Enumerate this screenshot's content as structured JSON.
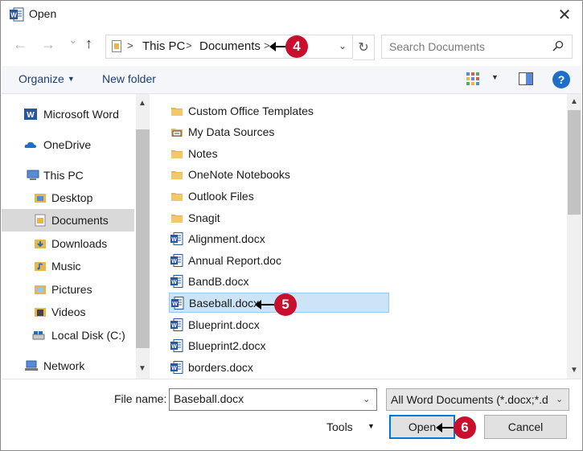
{
  "window": {
    "title": "Open",
    "app_icon": "word-app-icon",
    "close_glyph": "✕"
  },
  "address": {
    "back_glyph": "←",
    "forward_glyph": "→",
    "recent_glyph": "⌄",
    "up_glyph": "↑",
    "crumbs": [
      "This PC",
      "Documents"
    ],
    "sep_glyph": ">",
    "drop_glyph": "⌄",
    "refresh_glyph": "↻",
    "search_placeholder": "Search Documents"
  },
  "callouts": {
    "c4": "4",
    "c5": "5",
    "c6": "6",
    "color": "#c8102e"
  },
  "toolbar": {
    "organize": "Organize",
    "new_folder": "New folder",
    "caret": "▼",
    "help": "?"
  },
  "sidebar": {
    "items": [
      {
        "label": "Microsoft Word",
        "icon": "word-icon"
      },
      {
        "label": "OneDrive",
        "icon": "cloud-icon"
      },
      {
        "label": "This PC",
        "icon": "computer-icon"
      },
      {
        "label": "Desktop",
        "icon": "desktop-folder-icon"
      },
      {
        "label": "Documents",
        "icon": "documents-folder-icon"
      },
      {
        "label": "Downloads",
        "icon": "downloads-folder-icon"
      },
      {
        "label": "Music",
        "icon": "music-folder-icon"
      },
      {
        "label": "Pictures",
        "icon": "pictures-folder-icon"
      },
      {
        "label": "Videos",
        "icon": "videos-folder-icon"
      },
      {
        "label": "Local Disk (C:)",
        "icon": "disk-icon"
      },
      {
        "label": "Network",
        "icon": "network-icon"
      }
    ],
    "selected": "Documents"
  },
  "files": [
    {
      "name": "Custom Office Templates",
      "icon": "folder-icon"
    },
    {
      "name": "My Data Sources",
      "icon": "data-sources-folder-icon"
    },
    {
      "name": "Notes",
      "icon": "folder-icon"
    },
    {
      "name": "OneNote Notebooks",
      "icon": "folder-icon"
    },
    {
      "name": "Outlook Files",
      "icon": "folder-icon"
    },
    {
      "name": "Snagit",
      "icon": "folder-icon"
    },
    {
      "name": "Alignment.docx",
      "icon": "word-doc-icon"
    },
    {
      "name": "Annual Report.doc",
      "icon": "word-doc-icon"
    },
    {
      "name": "BandB.docx",
      "icon": "word-doc-icon"
    },
    {
      "name": "Baseball.docx",
      "icon": "word-doc-icon"
    },
    {
      "name": "Blueprint.docx",
      "icon": "word-doc-icon"
    },
    {
      "name": "Blueprint2.docx",
      "icon": "word-doc-icon"
    },
    {
      "name": "borders.docx",
      "icon": "word-doc-icon"
    }
  ],
  "selected_file": "Baseball.docx",
  "footer": {
    "file_name_label": "File name:",
    "file_name_value": "Baseball.docx",
    "filter": "All Word Documents (*.docx;*.d",
    "drop_glyph": "⌄",
    "tools": "Tools",
    "tools_caret": "▼",
    "open": "Open",
    "cancel": "Cancel"
  },
  "colors": {
    "accent": "#0078d7",
    "selection": "#cce4f7",
    "word_blue": "#2b579a",
    "folder": "#e8b64c"
  }
}
